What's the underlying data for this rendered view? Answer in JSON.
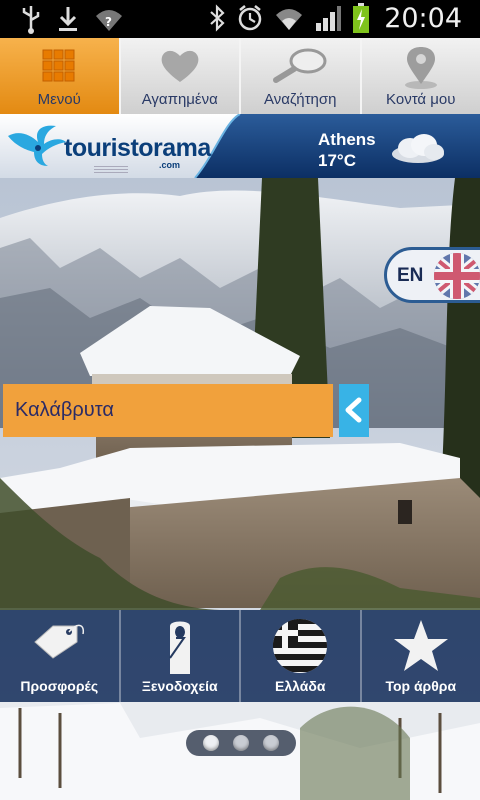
{
  "status_bar": {
    "time": "20:04",
    "icons": [
      "usb-icon",
      "download-icon",
      "wifi-question-icon",
      "bluetooth-icon",
      "alarm-icon",
      "wifi-icon",
      "signal-icon",
      "battery-charging-icon"
    ]
  },
  "tabs": [
    {
      "label": "Μενού",
      "icon": "grid-icon",
      "active": true
    },
    {
      "label": "Αγαπημένα",
      "icon": "heart-icon",
      "active": false
    },
    {
      "label": "Αναζήτηση",
      "icon": "magnifier-icon",
      "active": false
    },
    {
      "label": "Κοντά μου",
      "icon": "location-pin-icon",
      "active": false
    }
  ],
  "header": {
    "logo_text": "touristorama",
    "logo_sub": ".com",
    "weather": {
      "city": "Athens",
      "temp": "17°C",
      "icon": "cloud-icon"
    }
  },
  "language_toggle": {
    "label": "EN",
    "icon": "uk-flag-icon"
  },
  "location": {
    "label": "Καλάβρυτα",
    "arrow_icon": "chevron-left-icon"
  },
  "bottom_menu": [
    {
      "label": "Προσφορές",
      "icon": "tag-icon"
    },
    {
      "label": "Ξενοδοχεία",
      "icon": "door-hanger-icon"
    },
    {
      "label": "Ελλάδα",
      "icon": "greek-flag-icon"
    },
    {
      "label": "Top άρθρα",
      "icon": "star-icon"
    }
  ],
  "pager": {
    "count": 3,
    "active": 0
  },
  "colors": {
    "accent_orange": "#f1a13c",
    "navy": "#1c3f7a",
    "cyan": "#38b3e6"
  }
}
